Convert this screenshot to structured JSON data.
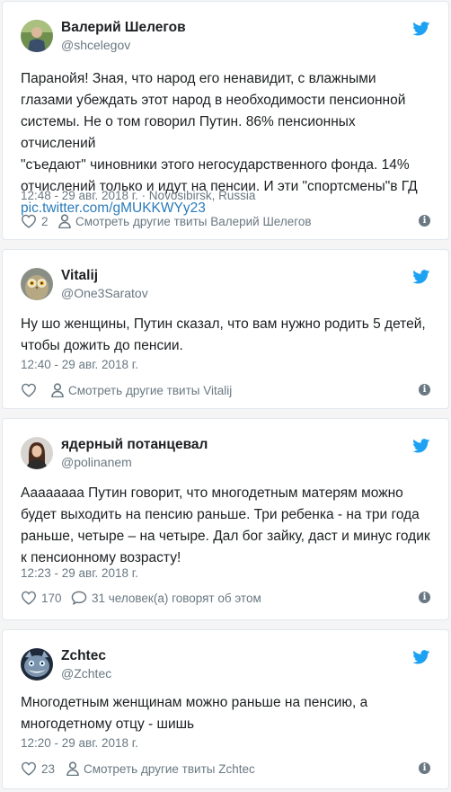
{
  "colors": {
    "background": "#f5f5f5",
    "card": "#ffffff",
    "border": "#e1e8ed",
    "text": "#1c2022",
    "muted": "#697882",
    "link": "#2b7bb9",
    "twitter_blue": "#1da1f2"
  },
  "tweets": [
    {
      "name": "Валерий Шелегов",
      "handle": "@shcelegov",
      "avatar_icon": "person-photo-avatar",
      "text_lines": [
        "Паранойя! Зная, что народ его ненавидит, с влажными",
        "глазами убеждать этот народ в необходимости пенсионной",
        "системы. Не о том говорил Путин. 86% пенсионных отчислений",
        "\"съедают\" чиновники этого негосударственного фонда. 14%",
        "отчислений только и идут на пенсии. И эти \"спортсмены\"в ГД"
      ],
      "link": "pic.twitter.com/gMUKKWYy23",
      "timestamp": "12:48 - 29 авг. 2018 г. · Novosibirsk, Russia",
      "likes": "2",
      "secondary_action": "Смотреть другие твиты Валерий Шелегов",
      "secondary_icon": "person-icon"
    },
    {
      "name": "Vitalij",
      "handle": "@One3Saratov",
      "avatar_icon": "owl-avatar",
      "text_lines": [
        "Ну шо женщины, Путин сказал, что вам нужно родить 5 детей,",
        "чтобы дожить до пенсии."
      ],
      "timestamp": "12:40 - 29 авг. 2018 г.",
      "likes": "",
      "secondary_action": "Смотреть другие твиты Vitalij",
      "secondary_icon": "person-icon"
    },
    {
      "name": "ядерный потанцевал",
      "handle": "@polinanem",
      "avatar_icon": "woman-photo-avatar",
      "text_lines": [
        "Аааааааа Путин говорит, что многодетным матерям можно",
        "будет выходить на пенсию раньше. Три ребенка - на три года",
        "раньше, четыре – на четыре. Дал бог зайку, даст и минус годик",
        "к пенсионному возрасту!"
      ],
      "timestamp": "12:23 - 29 авг. 2018 г.",
      "likes": "170",
      "secondary_action": "31 человек(а) говорят об этом",
      "secondary_icon": "speech-bubble-icon"
    },
    {
      "name": "Zchtec",
      "handle": "@Zchtec",
      "avatar_icon": "cat-avatar",
      "text_lines": [
        "Многодетным женщинам можно раньше на пенсию, а",
        "многодетному отцу - шишь"
      ],
      "timestamp": "12:20 - 29 авг. 2018 г.",
      "likes": "23",
      "secondary_action": "Смотреть другие твиты Zchtec",
      "secondary_icon": "person-icon"
    }
  ]
}
